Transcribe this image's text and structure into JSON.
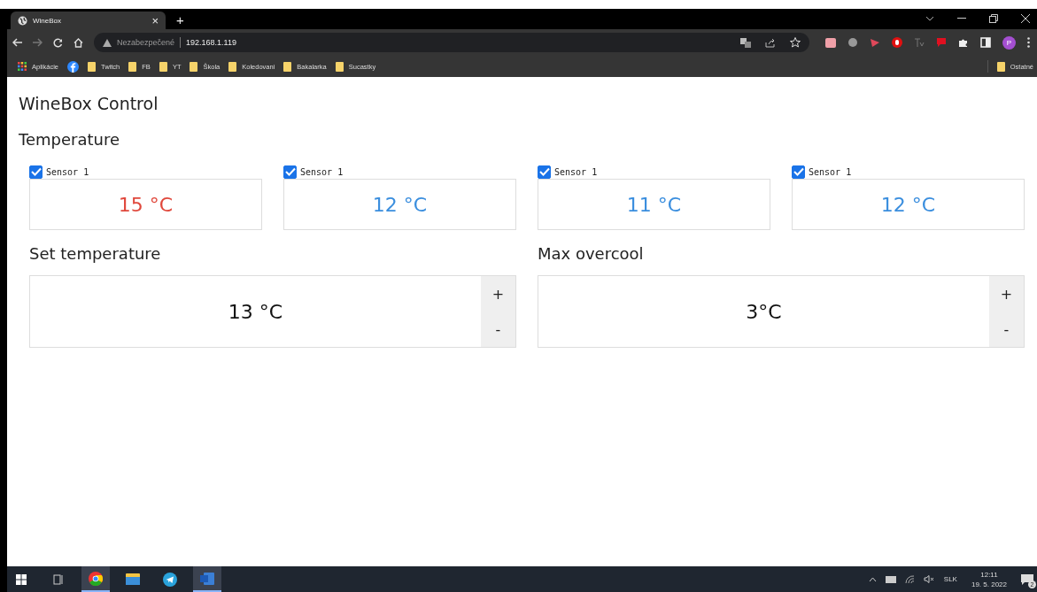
{
  "browser": {
    "tabs": [
      {
        "title": "WineBox",
        "selected": true
      }
    ],
    "new_tab": "+",
    "tab_close": "×",
    "address": {
      "security_label": "Nezabezpečené",
      "url": "192.168.1.119"
    },
    "profile_initial": "P",
    "bookmarks": [
      {
        "kind": "apps",
        "label": "Aplikácie"
      },
      {
        "kind": "facebook"
      },
      {
        "kind": "folder",
        "label": "Twitch"
      },
      {
        "kind": "folder",
        "label": "FB"
      },
      {
        "kind": "folder",
        "label": "YT"
      },
      {
        "kind": "folder",
        "label": "Škola"
      },
      {
        "kind": "folder",
        "label": "Koledovani"
      },
      {
        "kind": "folder",
        "label": "Bakalarka"
      },
      {
        "kind": "folder",
        "label": "Sucastky"
      }
    ],
    "other_bookmarks": "Ostatné"
  },
  "page": {
    "title": "WineBox Control",
    "section": "Temperature",
    "sensors": [
      {
        "label": "Sensor 1",
        "checked": true,
        "value": "15 °C",
        "color": "#e0483c"
      },
      {
        "label": "Sensor 1",
        "checked": true,
        "value": "12 °C",
        "color": "#3a8ede"
      },
      {
        "label": "Sensor 1",
        "checked": true,
        "value": "11 °C",
        "color": "#3a8ede"
      },
      {
        "label": "Sensor 1",
        "checked": true,
        "value": "12 °C",
        "color": "#3a8ede"
      }
    ],
    "settings": [
      {
        "label": "Set temperature",
        "value": "13 °C",
        "increase": "+",
        "decrease": "-"
      },
      {
        "label": "Max overcool",
        "value": "3°C",
        "increase": "+",
        "decrease": "-"
      }
    ]
  },
  "taskbar": {
    "apps": [
      {
        "kind": "start"
      },
      {
        "kind": "taskview"
      },
      {
        "kind": "chrome",
        "selected": true
      },
      {
        "kind": "explorer",
        "selected": false
      },
      {
        "kind": "telegram",
        "selected": false
      },
      {
        "kind": "word",
        "selected": true
      }
    ],
    "language": "SLK",
    "time": "12:11",
    "date": "19. 5. 2022",
    "notifications": "2"
  }
}
